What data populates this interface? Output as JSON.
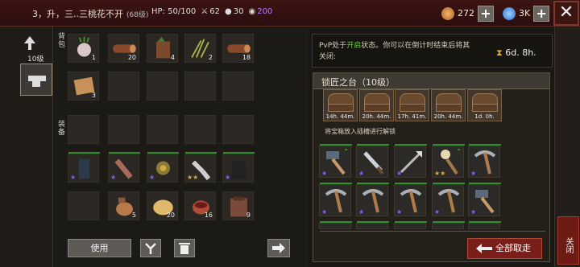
{
  "header": {
    "title": "3，升，三..三桃花不开",
    "level": "(68级)",
    "hp_label": "HP:",
    "hp_value": "50/100",
    "stat1": "62",
    "stat2": "30",
    "stat3": "200",
    "resource1": "272",
    "resource2": "3K"
  },
  "left": {
    "level_label": "10级"
  },
  "inventory": {
    "label_top": "背包",
    "label_bottom": "装备",
    "row1": [
      {
        "icon": "radish",
        "qty": "1"
      },
      {
        "icon": "log",
        "qty": "20"
      },
      {
        "icon": "stump",
        "qty": "4"
      },
      {
        "icon": "herb",
        "qty": "2"
      },
      {
        "icon": "log",
        "qty": "18"
      }
    ],
    "row2_first_qty": "3",
    "row4": [
      {
        "icon": "bottle",
        "qty": "5"
      },
      {
        "icon": "bread",
        "qty": "20"
      },
      {
        "icon": "cup",
        "qty": "16"
      },
      {
        "icon": "pack",
        "qty": "9"
      }
    ],
    "use_button": "使用"
  },
  "pvp": {
    "text_a": "PvP处于",
    "text_open": "开启",
    "text_b": "状态。你可以在倒计时结束后将其关闭:",
    "timer": "6d. 8h."
  },
  "forge": {
    "title": "锁匠之台（10级）",
    "chests": [
      "14h. 44m.",
      "20h. 44m.",
      "17h. 41m.",
      "20h. 44m.",
      "1d. 0h."
    ],
    "hint": "将宝箱放入插槽进行解锁",
    "take_all": "全部取走"
  },
  "right": {
    "close_label": "关闭"
  }
}
